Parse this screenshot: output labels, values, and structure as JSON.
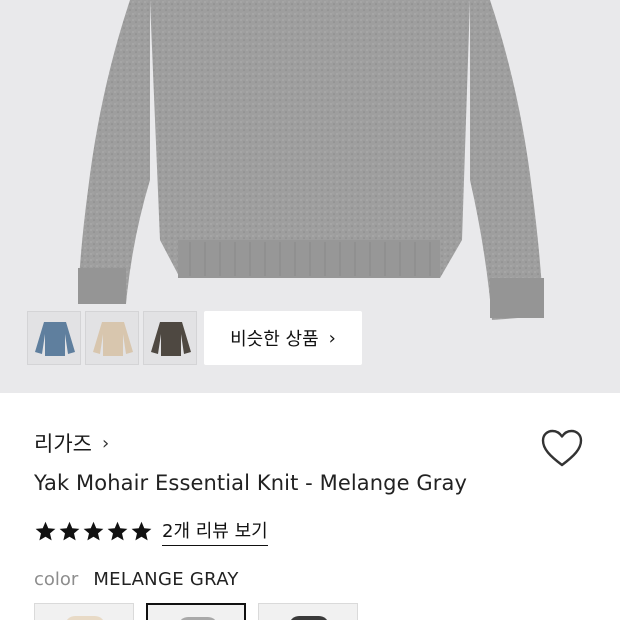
{
  "hero": {
    "thumbnails": [
      {
        "icon": "sweater-thumbnail-blue",
        "color": "#5f7f9e"
      },
      {
        "icon": "sweater-thumbnail-beige",
        "color": "#d8c6ae"
      },
      {
        "icon": "sweater-thumbnail-brown",
        "color": "#4e4841"
      }
    ],
    "similar_button": {
      "label": "비슷한 상품",
      "chevron": "›"
    }
  },
  "product": {
    "brand": "리가즈",
    "brand_chevron": "›",
    "title": "Yak Mohair Essential Knit - Melange Gray",
    "rating": {
      "stars": 5,
      "max": 5,
      "review_link": "2개 리뷰 보기"
    },
    "color": {
      "label": "color",
      "value": "MELANGE GRAY"
    },
    "swatches": [
      {
        "name": "beige",
        "color": "#e8dac6",
        "selected": false
      },
      {
        "name": "gray",
        "color": "#a9a9a9",
        "selected": true
      },
      {
        "name": "charcoal",
        "color": "#3a3a3a",
        "selected": false
      }
    ]
  },
  "colors": {
    "hero_bg": "#e9e9eb",
    "sweater": "#9d9d9d",
    "text": "#1a1a1a",
    "muted": "#8d8d8d"
  }
}
